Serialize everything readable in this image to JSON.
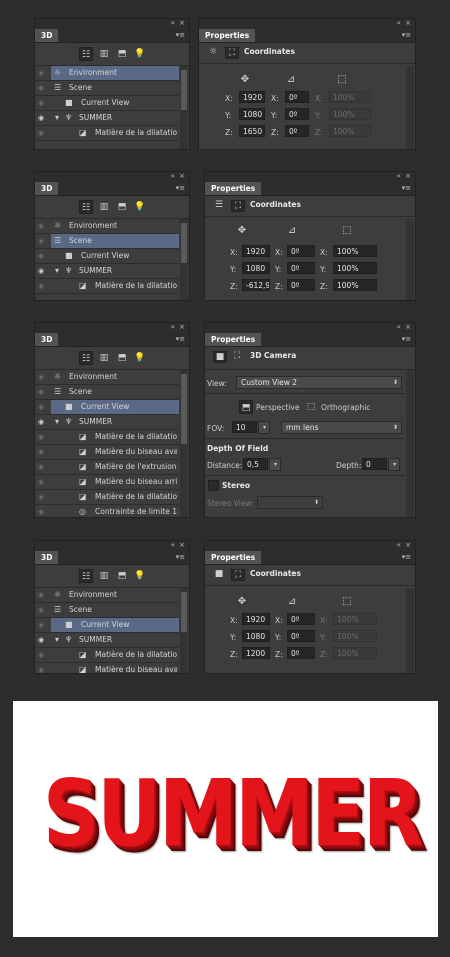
{
  "ui": {
    "collapse": "«",
    "close": "×",
    "menu": "▾≡"
  },
  "panel3d": [
    {
      "tab": "3D",
      "rows": [
        {
          "label": "Environment"
        },
        {
          "label": "Scene"
        },
        {
          "label": "Current View"
        },
        {
          "label": "SUMMER",
          "expand": "▾"
        },
        {
          "label": "Matière de la dilatatio..."
        }
      ]
    },
    {
      "tab": "3D",
      "rows": [
        {
          "label": "Environment"
        },
        {
          "label": "Scene"
        },
        {
          "label": "Current View"
        },
        {
          "label": "SUMMER",
          "expand": "▾"
        },
        {
          "label": "Matière de la dilatatio..."
        }
      ]
    },
    {
      "tab": "3D",
      "rows": [
        {
          "label": "Environment"
        },
        {
          "label": "Scene"
        },
        {
          "label": "Current View"
        },
        {
          "label": "SUMMER",
          "expand": "▾"
        },
        {
          "label": "Matière de la dilatatio..."
        },
        {
          "label": "Matière du biseau ava..."
        },
        {
          "label": "Matière de l'extrusion ..."
        },
        {
          "label": "Matière du biseau arri..."
        },
        {
          "label": "Matière de la dilatatio..."
        },
        {
          "label": "Contrainte de limite 1"
        }
      ]
    },
    {
      "tab": "3D",
      "rows": [
        {
          "label": "Environment"
        },
        {
          "label": "Scene"
        },
        {
          "label": "Current View"
        },
        {
          "label": "SUMMER",
          "expand": "▾"
        },
        {
          "label": "Matière de la dilatatio..."
        },
        {
          "label": "Matière du biseau ava..."
        }
      ]
    }
  ],
  "props1": {
    "tab": "Properties",
    "title": "Coordinates",
    "rows": [
      {
        "l1": "X:",
        "v1": "1920",
        "l2": "X:",
        "v2": "0º",
        "l3": "X:",
        "v3": "100%"
      },
      {
        "l1": "Y:",
        "v1": "1080",
        "l2": "Y:",
        "v2": "0º",
        "l3": "Y:",
        "v3": "100%"
      },
      {
        "l1": "Z:",
        "v1": "1650",
        "l2": "Z:",
        "v2": "0º",
        "l3": "Z:",
        "v3": "100%"
      }
    ]
  },
  "props2": {
    "tab": "Properties",
    "title": "Coordinates",
    "rows": [
      {
        "l1": "X:",
        "v1": "1920",
        "l2": "X:",
        "v2": "0º",
        "l3": "X:",
        "v3": "100%"
      },
      {
        "l1": "Y:",
        "v1": "1080",
        "l2": "Y:",
        "v2": "0º",
        "l3": "Y:",
        "v3": "100%"
      },
      {
        "l1": "Z:",
        "v1": "-612,9",
        "l2": "Z:",
        "v2": "0º",
        "l3": "Z:",
        "v3": "100%"
      }
    ]
  },
  "props3": {
    "tab": "Properties",
    "title": "3D Camera",
    "view_label": "View:",
    "view_value": "Custom View 2",
    "perspective": "Perspective",
    "orthographic": "Orthographic",
    "fov_label": "FOV:",
    "fov_value": "10",
    "lens_value": "mm lens",
    "dof_title": "Depth Of Field",
    "distance_label": "Distance:",
    "distance_value": "0,5",
    "depth_label": "Depth:",
    "depth_value": "0",
    "stereo_label": "Stereo",
    "stereo_view_label": "Stereo View:"
  },
  "props4": {
    "tab": "Properties",
    "title": "Coordinates",
    "rows": [
      {
        "l1": "X:",
        "v1": "1920",
        "l2": "X:",
        "v2": "0º",
        "l3": "X:",
        "v3": "100%"
      },
      {
        "l1": "Y:",
        "v1": "1080",
        "l2": "Y:",
        "v2": "0º",
        "l3": "Y:",
        "v3": "100%"
      },
      {
        "l1": "Z:",
        "v1": "1200",
        "l2": "Z:",
        "v2": "0º",
        "l3": "Z:",
        "v3": "100%"
      }
    ]
  },
  "preview": {
    "text": "SUMMER",
    "color": "#e3151a"
  }
}
